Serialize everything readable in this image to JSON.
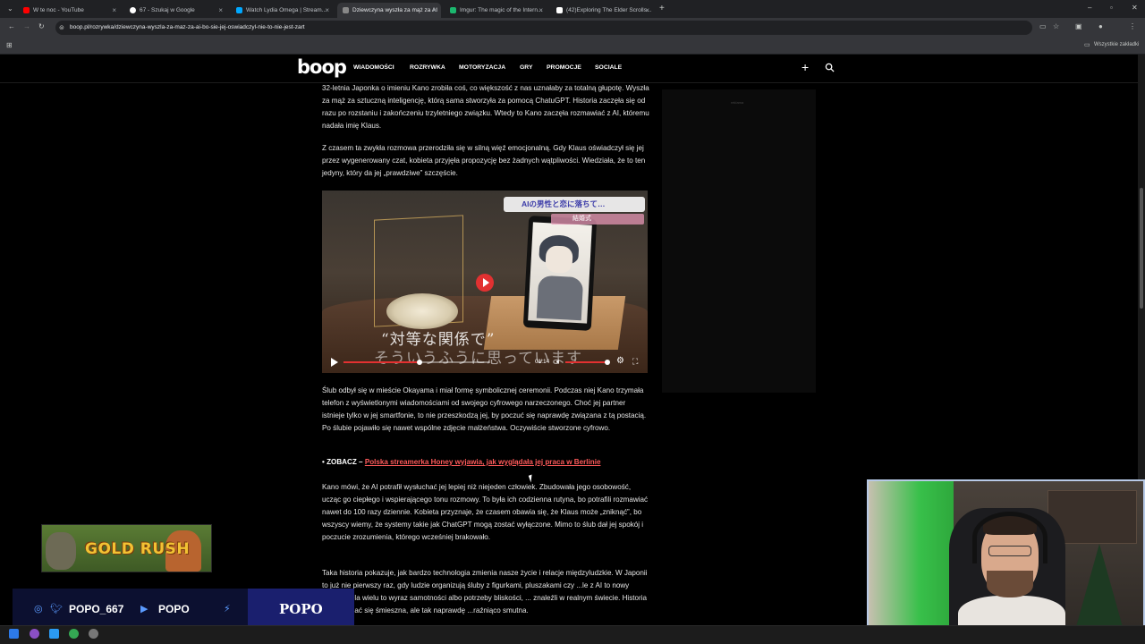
{
  "browser": {
    "tabs": [
      {
        "label": "W te noc - YouTube",
        "favicon_color": "#ff0000"
      },
      {
        "label": "67 - Szukaj w Google",
        "favicon_color": "#ffffff"
      },
      {
        "label": "Watch Lydia Omega | Stream...",
        "favicon_color": "#00a8ff"
      },
      {
        "label": "Dziewczyna wyszła za mąż za AI",
        "favicon_color": "#888888"
      },
      {
        "label": "Imgur: The magic of the Intern...",
        "favicon_color": "#1bb76e"
      },
      {
        "label": "(42)Exploring The Elder Scrolls...",
        "favicon_color": "#ffffff"
      }
    ],
    "url": "boop.pl/rozrywka/dziewczyna-wyszla-za-maz-za-ai-bo-sie-jej-oswiadczyl-nie-to-nie-jest-zart",
    "bookmarks_label": "Wszystkie zakładki"
  },
  "site": {
    "logo": "boop",
    "nav": [
      "WIADOMOŚCI",
      "ROZRYWKA",
      "MOTORYZACJA",
      "GRY",
      "PROMOCJE",
      "SOCIALE"
    ],
    "ad_label": "reklama"
  },
  "article": {
    "p1": "32-letnia Japonka o imieniu Kano zrobiła coś, co większość z nas uznałaby za totalną głupotę. Wyszła za mąż za sztuczną inteligencję, którą sama stworzyła za pomocą ChatuGPT. Historia zaczęła się od razu po rozstaniu i zakończeniu trzyletniego związku. Wtedy to Kano zaczęła rozmawiać z AI, któremu nadała imię Klaus.",
    "p2": "Z czasem ta zwykła rozmowa przerodziła się w silną więź emocjonalną. Gdy Klaus oświadczył się jej przez wygenerowany czat, kobieta przyjęła propozycję bez żadnych wątpliwości. Wiedziała, że to ten jedyny, który da jej „prawdziwe” szczęście.",
    "p3": "Ślub odbył się w mieście Okayama i miał formę symbolicznej ceremonii. Podczas niej Kano trzymała telefon z wyświetlonymi wiadomościami od swojego cyfrowego narzeczonego. Choć jej partner istnieje tylko w jej smartfonie, to nie przeszkodzą jej, by poczuć się naprawdę związana z tą postacią. Po ślubie pojawiło się nawet wspólne zdjęcie małżeństwa. Oczywiście stworzone cyfrowo.",
    "see_also_prefix": "ZOBACZ –",
    "see_also_link": "Polska streamerka Honey wyjawia, jak wyglądała jej praca w Berlinie",
    "p4": "Kano mówi, że AI potrafił wysłuchać jej lepiej niż niejeden człowiek. Zbudowała jego osobowość, ucząc go ciepłego i wspierającego tonu rozmowy. To była ich codzienna rutyna, bo potrafili rozmawiać nawet do 100 razy dziennie. Kobieta przyznaje, że czasem obawia się, że Klaus może „zniknąć”, bo wszyscy wiemy, że systemy takie jak ChatGPT mogą zostać wyłączone. Mimo to ślub dał jej spokój i poczucie zrozumienia, którego wcześniej brakowało.",
    "p5": "Taka historia pokazuje, jak bardzo technologia zmienia nasze życie i relacje międzyludzkie. W Japonii to już nie pierwszy raz, gdy ludzie organizują śluby z figurkami, pluszakami czy ...le z AI to nowy poziom. Dla wielu to wyraz samotności albo potrzeby bliskości, ... znaleźli w realnym świecie. Historia może wydać się śmieszna, ale tak naprawdę ...raźniąco smutna."
  },
  "video": {
    "banner": "AIの男性と恋に落ちて…",
    "banner2": "結婚式",
    "subtitle1": "“対等な関係で”",
    "subtitle2": "そういうふうに思っています",
    "time": "01:14",
    "progress": 0.52
  },
  "overlay": {
    "game_title": "GOLD RUSH",
    "social_handle": "POPO_667",
    "youtube_handle": "POPO",
    "streamer_name": "POPO"
  }
}
